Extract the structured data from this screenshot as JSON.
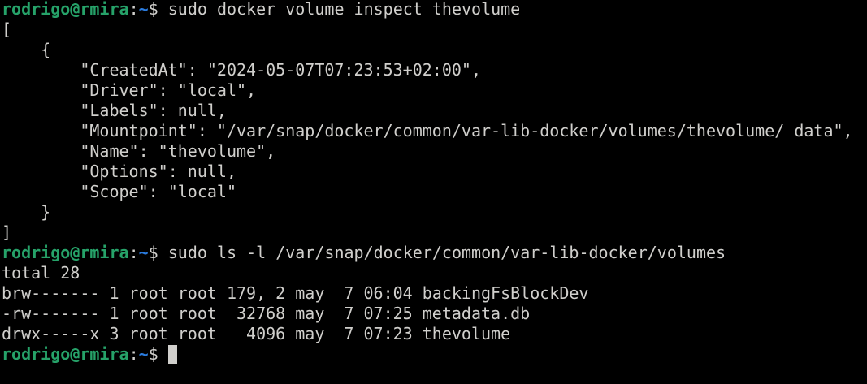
{
  "terminal": {
    "colors": {
      "background": "#000000",
      "foreground": "#d0cfcc",
      "prompt_user_host": "#26a269",
      "prompt_path": "#2a7bde"
    },
    "prompt": {
      "user": "rodrigo",
      "at": "@",
      "host": "rmira",
      "colon": ":",
      "path": "~",
      "dollar": "$ "
    },
    "command1": "sudo docker volume inspect thevolume",
    "inspect_output": [
      "[",
      "    {",
      "        \"CreatedAt\": \"2024-05-07T07:23:53+02:00\",",
      "        \"Driver\": \"local\",",
      "        \"Labels\": null,",
      "        \"Mountpoint\": \"/var/snap/docker/common/var-lib-docker/volumes/thevolume/_data\",",
      "        \"Name\": \"thevolume\",",
      "        \"Options\": null,",
      "        \"Scope\": \"local\"",
      "    }",
      "]"
    ],
    "command2": "sudo ls -l /var/snap/docker/common/var-lib-docker/volumes",
    "ls_output": [
      "total 28",
      "brw------- 1 root root 179, 2 may  7 06:04 backingFsBlockDev",
      "-rw------- 1 root root  32768 may  7 07:25 metadata.db",
      "drwx-----x 3 root root   4096 may  7 07:23 thevolume"
    ]
  }
}
